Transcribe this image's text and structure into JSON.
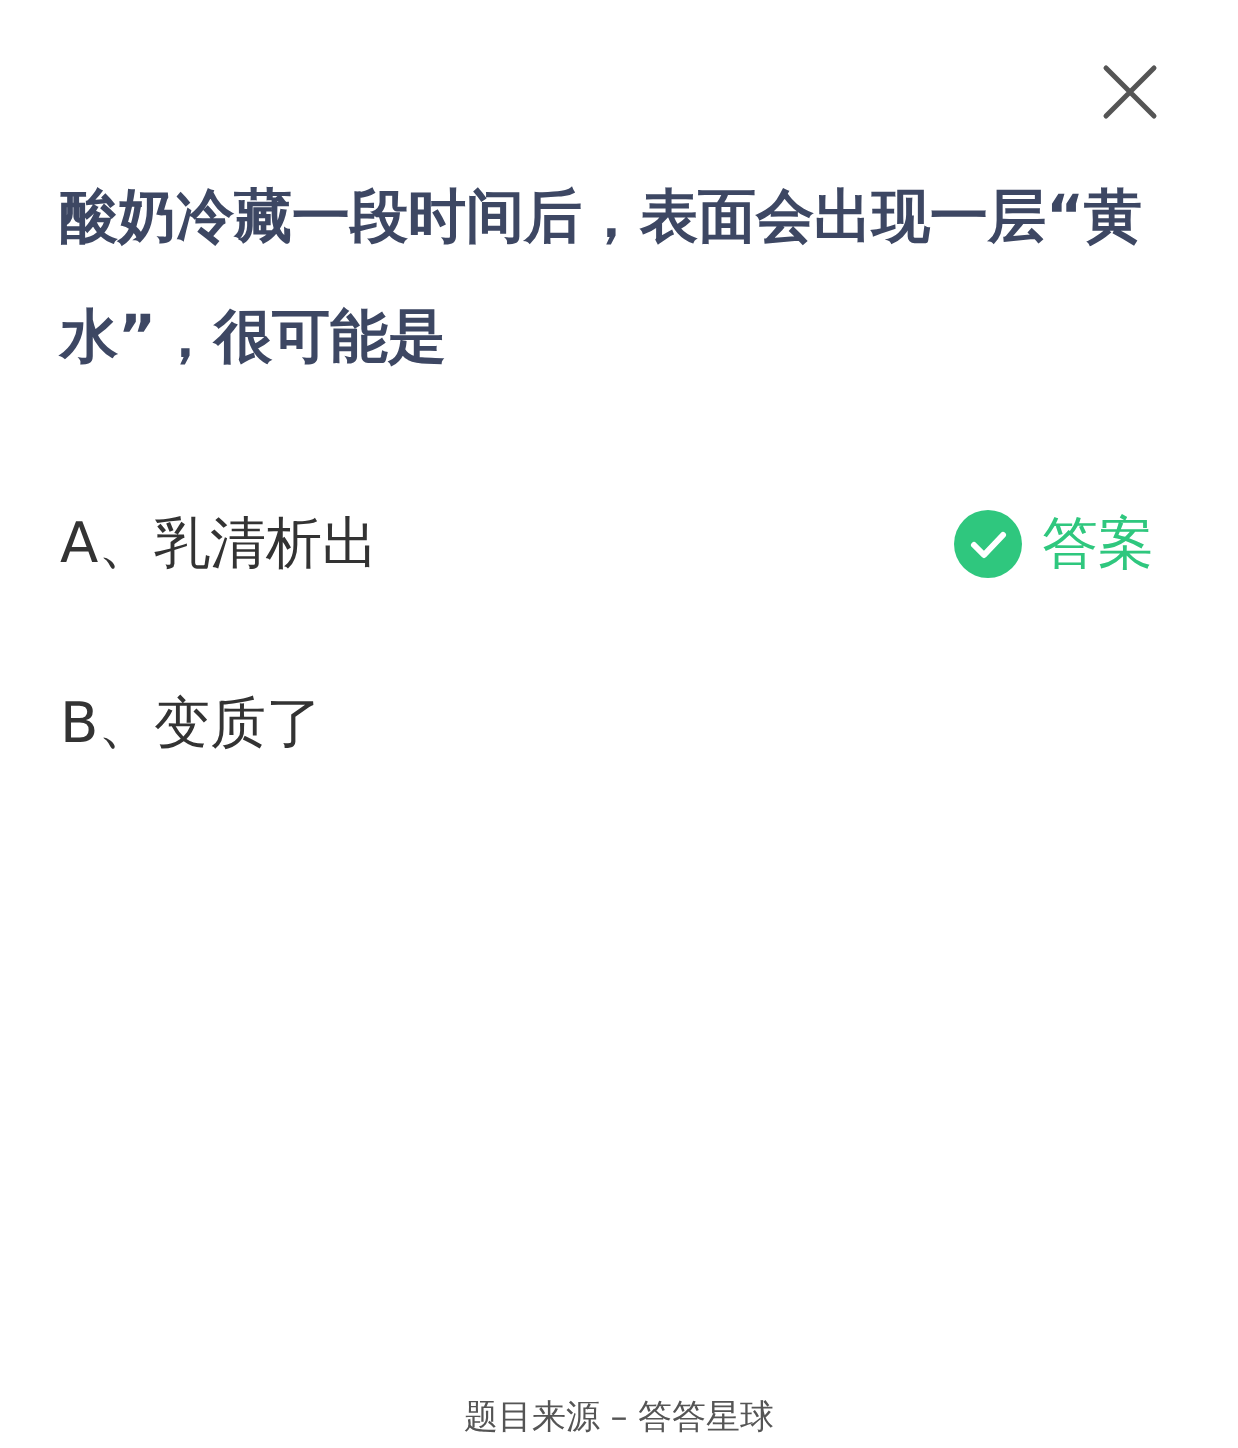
{
  "question": "酸奶冷藏一段时间后，表面会出现一层“黄水”，很可能是",
  "options": [
    {
      "label": "A、乳清析出",
      "is_answer": true
    },
    {
      "label": "B、变质了",
      "is_answer": false
    }
  ],
  "answer_badge": "答案",
  "footer": "题目来源 – 答答星球"
}
